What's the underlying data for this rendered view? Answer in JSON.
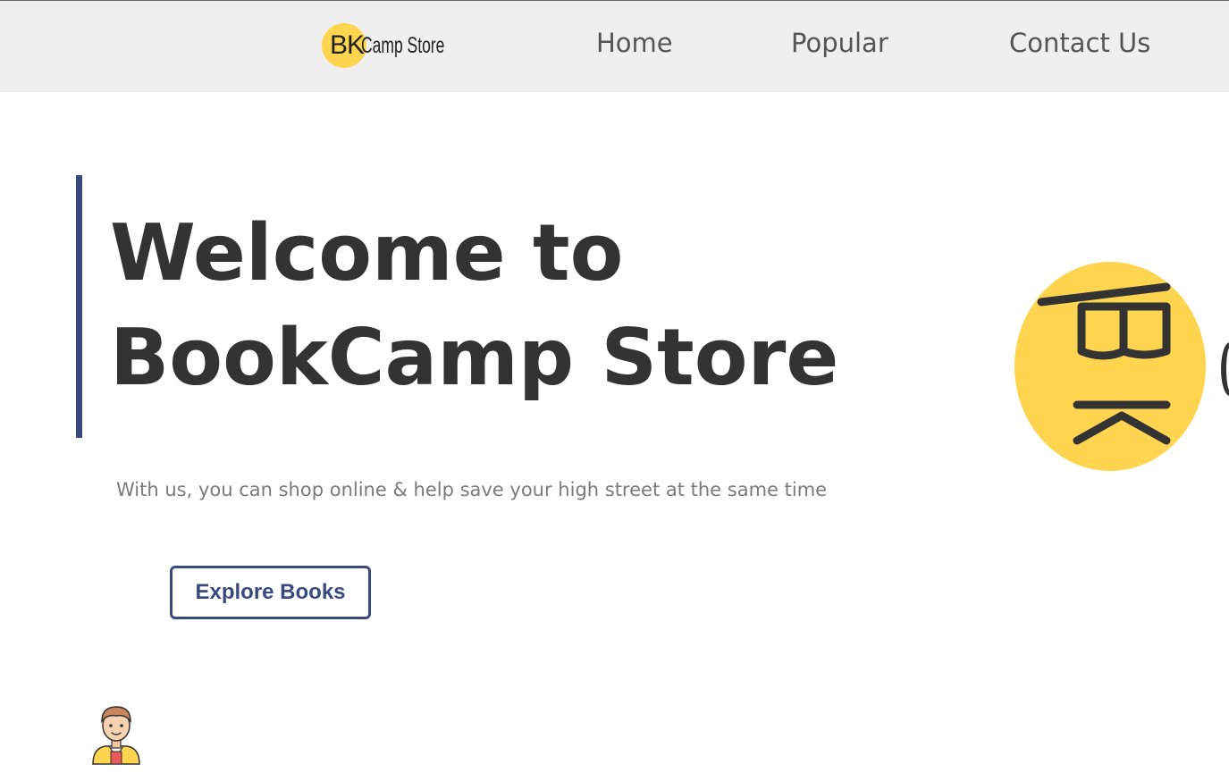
{
  "header": {
    "logo": {
      "letters": "BK",
      "text": "Camp Store",
      "badge_color": "#ffd54f"
    },
    "nav": [
      {
        "label": "Home"
      },
      {
        "label": "Popular"
      },
      {
        "label": "Contact Us"
      }
    ]
  },
  "hero": {
    "title_line1": "Welcome to",
    "title_line2": "BookCamp Store",
    "subtitle": "With us, you can shop online & help save your high street at the same time",
    "cta_label": "Explore Books",
    "accent_color": "#3b4a7e"
  },
  "decor": {
    "big_logo_icon": "bk-logo-rotated-icon",
    "avatar_icon": "user-avatar-icon"
  }
}
